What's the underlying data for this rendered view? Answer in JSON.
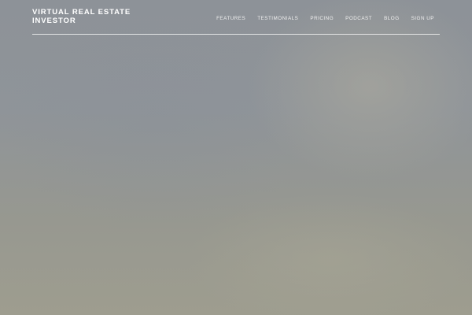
{
  "header": {
    "brand_line1": "VIRTUAL REAL ESTATE",
    "brand_line2": "INVESTOR",
    "nav": [
      {
        "label": "FEATURES"
      },
      {
        "label": "TESTIMONIALS"
      },
      {
        "label": "PRICING"
      },
      {
        "label": "PODCAST"
      },
      {
        "label": "BLOG"
      },
      {
        "label": "SIGN UP"
      }
    ]
  },
  "colors": {
    "text": "#ffffff",
    "background": "#8f9499"
  }
}
